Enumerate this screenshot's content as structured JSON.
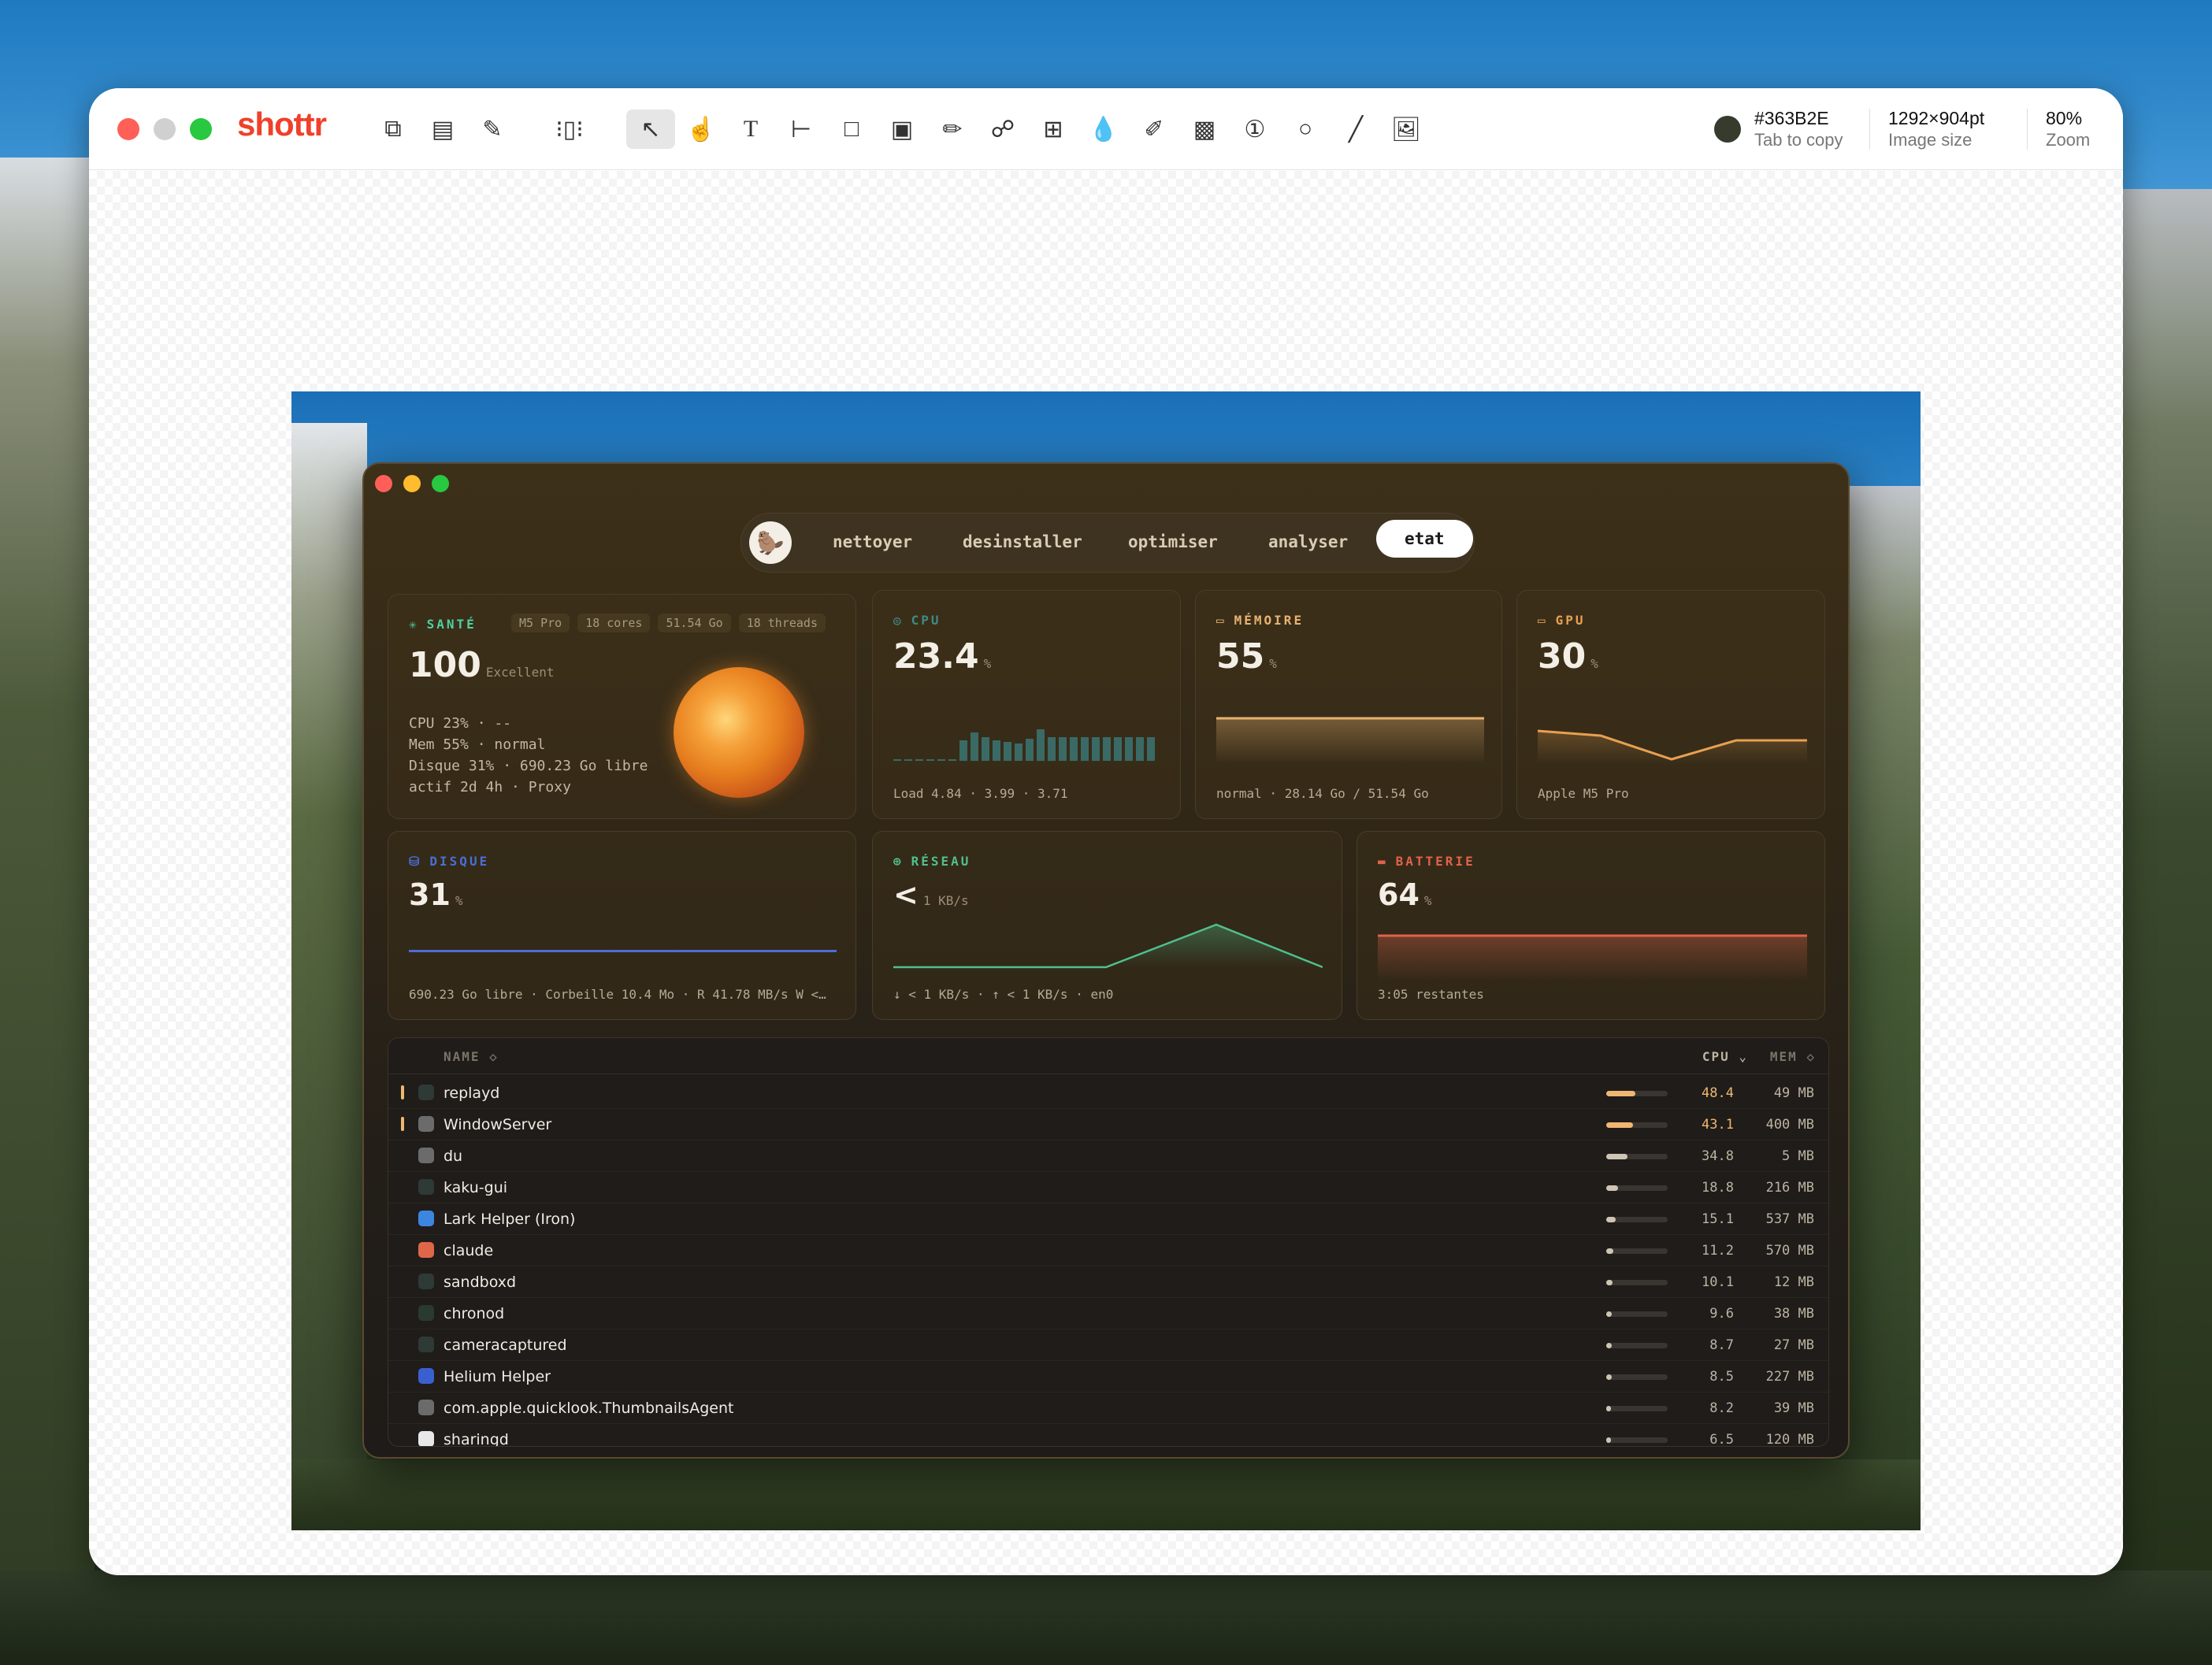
{
  "toolbar": {
    "app_name": "shottr",
    "color_value": "#363B2E",
    "color_hint": "Tab to copy",
    "image_size_value": "1292×904pt",
    "image_size_label": "Image size",
    "zoom_value": "80%",
    "zoom_label": "Zoom",
    "swatch_color": "#363B2E"
  },
  "app": {
    "tabs": [
      "nettoyer",
      "desinstaller",
      "optimiser",
      "analyser",
      "etat"
    ],
    "active_tab": "etat",
    "health": {
      "title": "SANTÉ",
      "pills": [
        "M5 Pro",
        "18 cores",
        "51.54 Go",
        "18 threads"
      ],
      "score": "100",
      "score_label": "Excellent",
      "lines": [
        "CPU 23% · --",
        "Mem 55% · normal",
        "Disque 31% · 690.23 Go libre",
        "actif 2d 4h · Proxy"
      ]
    },
    "cpu": {
      "title": "CPU",
      "value": "23.4",
      "unit": "%",
      "footer": "Load 4.84 · 3.99 · 3.71"
    },
    "memory": {
      "title": "MÉMOIRE",
      "value": "55",
      "unit": "%",
      "footer": "normal · 28.14 Go / 51.54 Go"
    },
    "gpu": {
      "title": "GPU",
      "value": "30",
      "unit": "%",
      "footer": "Apple M5 Pro"
    },
    "disk": {
      "title": "DISQUE",
      "value": "31",
      "unit": "%",
      "footer": "690.23 Go libre · Corbeille 10.4 Mo · R 41.78 MB/s W <…"
    },
    "network": {
      "title": "RÉSEAU",
      "value": "<",
      "unit": "1 KB/s",
      "footer": "↓ < 1 KB/s · ↑ < 1 KB/s · en0"
    },
    "battery": {
      "title": "BATTERIE",
      "value": "64",
      "unit": "%",
      "footer": "3:05 restantes"
    },
    "process_table": {
      "col_name": "NAME ◇",
      "col_cpu": "CPU ⌄",
      "col_mem": "MEM ◇",
      "rows": [
        {
          "name": "replayd",
          "cpu": "48.4",
          "mem": "49 MB",
          "cpu_frac": 0.48,
          "highlight": true,
          "icon_color": "#2e3a35"
        },
        {
          "name": "WindowServer",
          "cpu": "43.1",
          "mem": "400 MB",
          "cpu_frac": 0.43,
          "highlight": true,
          "icon_color": "#6b6b6b"
        },
        {
          "name": "du",
          "cpu": "34.8",
          "mem": "5 MB",
          "cpu_frac": 0.35,
          "highlight": false,
          "icon_color": "#6b6b6b"
        },
        {
          "name": "kaku-gui",
          "cpu": "18.8",
          "mem": "216 MB",
          "cpu_frac": 0.19,
          "highlight": false,
          "icon_color": "#2e3a35"
        },
        {
          "name": "Lark Helper (Iron)",
          "cpu": "15.1",
          "mem": "537 MB",
          "cpu_frac": 0.15,
          "highlight": false,
          "icon_color": "#3c86e0"
        },
        {
          "name": "claude",
          "cpu": "11.2",
          "mem": "570 MB",
          "cpu_frac": 0.11,
          "highlight": false,
          "icon_color": "#e0664a"
        },
        {
          "name": "sandboxd",
          "cpu": "10.1",
          "mem": "12 MB",
          "cpu_frac": 0.1,
          "highlight": false,
          "icon_color": "#2e3a35"
        },
        {
          "name": "chronod",
          "cpu": "9.6",
          "mem": "38 MB",
          "cpu_frac": 0.096,
          "highlight": false,
          "icon_color": "#2a3a30"
        },
        {
          "name": "cameracaptured",
          "cpu": "8.7",
          "mem": "27 MB",
          "cpu_frac": 0.087,
          "highlight": false,
          "icon_color": "#2e3a35"
        },
        {
          "name": "Helium Helper",
          "cpu": "8.5",
          "mem": "227 MB",
          "cpu_frac": 0.085,
          "highlight": false,
          "icon_color": "#3a5fd0"
        },
        {
          "name": "com.apple.quicklook.ThumbnailsAgent",
          "cpu": "8.2",
          "mem": "39 MB",
          "cpu_frac": 0.082,
          "highlight": false,
          "icon_color": "#6b6b6b"
        },
        {
          "name": "sharingd",
          "cpu": "6.5",
          "mem": "120 MB",
          "cpu_frac": 0.065,
          "highlight": false,
          "icon_color": "#e8e8e8"
        }
      ]
    },
    "accent_colors": {
      "health": "#4fd1a0",
      "cpu": "#3f8a84",
      "memory": "#e8b370",
      "gpu": "#e8a050",
      "disk": "#4a6ed8",
      "network": "#4fc08f",
      "battery": "#e0624a"
    }
  }
}
